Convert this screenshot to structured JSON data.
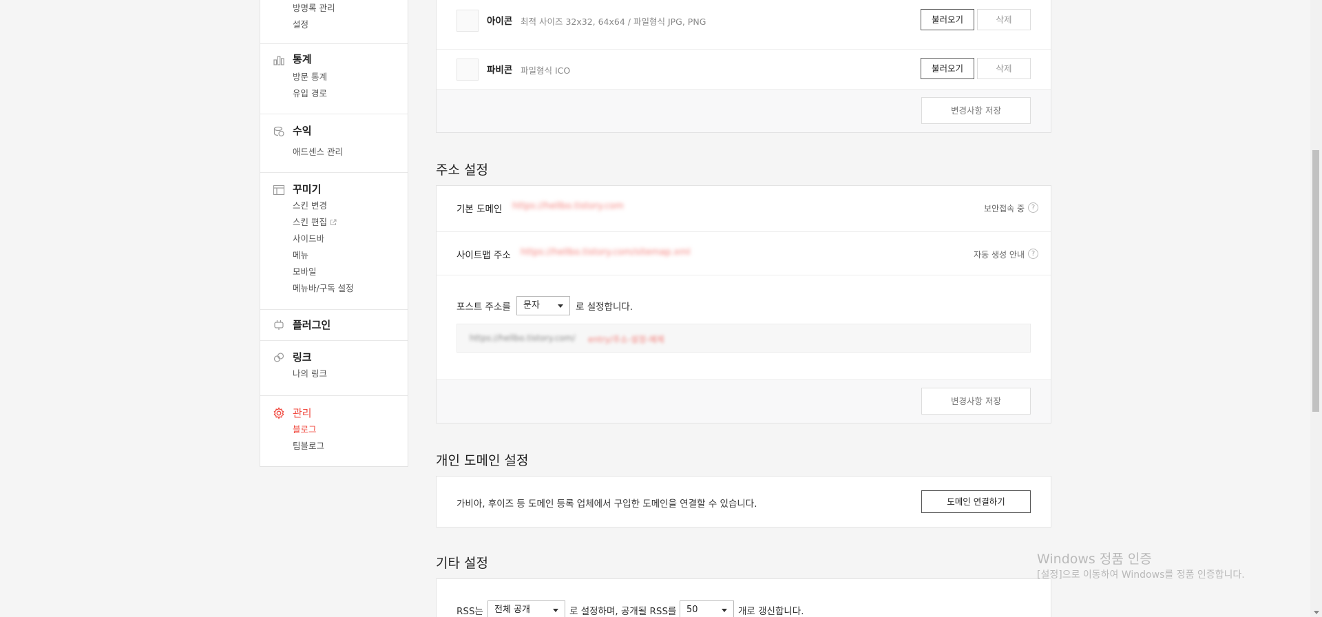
{
  "sidebar": {
    "guestbook": {
      "items": [
        "방명록 관리",
        "설정"
      ]
    },
    "stats": {
      "icon": "bar-chart-icon",
      "title": "통계",
      "items": [
        "방문 통계",
        "유입 경로"
      ]
    },
    "revenue": {
      "icon": "coins-icon",
      "title": "수익",
      "items": [
        "애드센스 관리"
      ]
    },
    "design": {
      "icon": "layout-icon",
      "title": "꾸미기",
      "items": [
        "스킨 변경",
        "스킨 편집",
        "사이드바",
        "메뉴",
        "모바일",
        "메뉴바/구독 설정"
      ]
    },
    "plugin": {
      "icon": "plug-icon",
      "title": "플러그인"
    },
    "link": {
      "icon": "link-icon",
      "title": "링크",
      "items": [
        "나의 링크"
      ]
    },
    "manage": {
      "icon": "gear-icon",
      "title": "관리",
      "items": [
        "블로그",
        "팀블로그"
      ],
      "active_item": "블로그"
    }
  },
  "icons_box": {
    "icon_row": {
      "label": "아이콘",
      "desc": "최적 사이즈 32x32, 64x64 / 파일형식 JPG, PNG",
      "load": "불러오기",
      "delete": "삭제"
    },
    "favicon_row": {
      "label": "파비콘",
      "desc": "파일형식 ICO",
      "load": "불러오기",
      "delete": "삭제"
    },
    "save": "변경사항 저장"
  },
  "address": {
    "title": "주소 설정",
    "default_domain": {
      "label": "기본 도메인",
      "value": "https://hellbo.tistory.com",
      "right": "보안접속 중"
    },
    "sitemap": {
      "label": "사이트맵 주소",
      "value": "https://hellbo.tistory.com/sitemap.xml",
      "right": "자동 생성 안내"
    },
    "post_address": {
      "prefix": "포스트 주소를",
      "select": "문자",
      "suffix": "로 설정합니다."
    },
    "preview": {
      "base": "https://hellbo.tistory.com/",
      "slug": "entry/주소-설정-예제"
    },
    "save": "변경사항 저장"
  },
  "personal_domain": {
    "title": "개인 도메인 설정",
    "desc": "가비아, 후이즈 등 도메인 등록 업체에서 구입한 도메인을 연결할 수 있습니다.",
    "button": "도메인 연결하기"
  },
  "other": {
    "title": "기타 설정",
    "rss_prefix": "RSS는",
    "rss_select": "전체 공개",
    "rss_mid": "로 설정하며, 공개될 RSS를",
    "rss_count": "50",
    "rss_suffix": "개로 갱신합니다."
  },
  "watermark": {
    "line1": "Windows 정품 인증",
    "line2": "[설정]으로 이동하여 Windows를 정품 인증합니다."
  },
  "colors": {
    "accent": "#f0483e"
  }
}
